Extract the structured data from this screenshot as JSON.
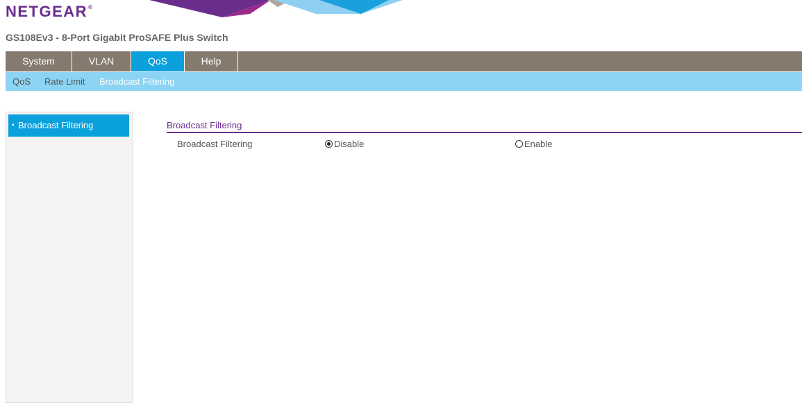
{
  "logo": {
    "text": "NETGEAR",
    "mark": "®"
  },
  "product_title": "GS108Ev3 - 8-Port Gigabit ProSAFE Plus Switch",
  "main_nav": {
    "items": [
      "System",
      "VLAN",
      "QoS",
      "Help"
    ],
    "active": "QoS"
  },
  "sub_nav": {
    "items": [
      "QoS",
      "Rate Limit",
      "Broadcast Filtering"
    ],
    "active": "Broadcast Filtering"
  },
  "sidebar": {
    "items": [
      {
        "label": "Broadcast Filtering",
        "bullet": "▪",
        "active": true
      }
    ]
  },
  "content": {
    "section_title": "Broadcast Filtering",
    "field_label": "Broadcast Filtering",
    "options": [
      {
        "label": "Disable",
        "checked": true
      },
      {
        "label": "Enable",
        "checked": false
      }
    ]
  },
  "colors": {
    "brand_purple": "#6a2e8e",
    "nav_bg": "#857a6e",
    "nav_active": "#0aa0dc",
    "subnav_bg": "#8cd4f3"
  }
}
